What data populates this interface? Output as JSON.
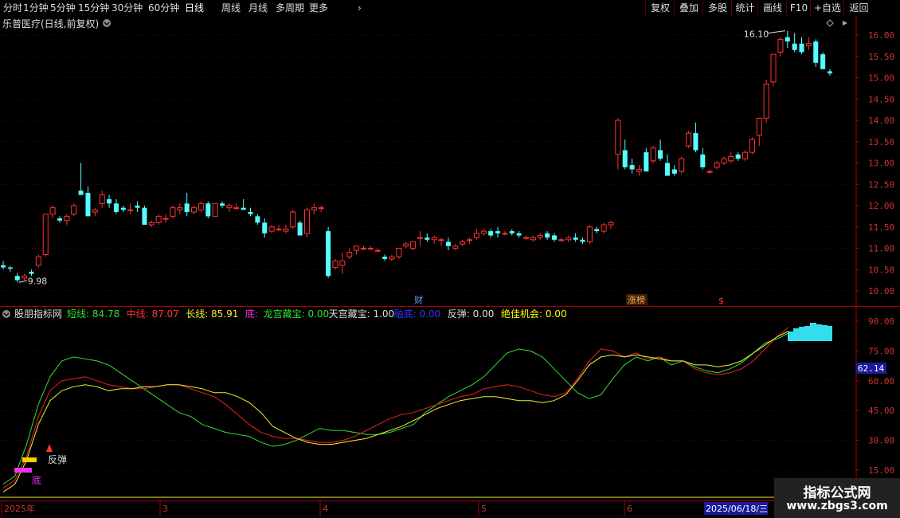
{
  "toolbar": {
    "periods": [
      "分时",
      "1分钟",
      "5分钟",
      "15分钟",
      "30分钟",
      "60分钟",
      "日线",
      "周线",
      "月线",
      "多周期",
      "更多"
    ],
    "active_period": "日线",
    "right_buttons": [
      "复权",
      "叠加",
      "多股",
      "统计",
      "画线",
      "F10",
      "+自选",
      "返回"
    ]
  },
  "main": {
    "title": "乐普医疗(日线,前复权)",
    "price_axis": [
      "16.00",
      "15.50",
      "15.00",
      "14.50",
      "14.00",
      "13.50",
      "13.00",
      "12.50",
      "12.00",
      "11.50",
      "11.00",
      "10.50",
      "10.00"
    ],
    "high_label": "16.10",
    "low_label": "9.98",
    "event_labels": {
      "cai": "财",
      "zhangbang": "涨榜",
      "s": "$"
    }
  },
  "indicator": {
    "name": "股朋指标网",
    "items": [
      {
        "label": "短线:",
        "value": "84.78",
        "color": "#33dd33"
      },
      {
        "label": "中线:",
        "value": "87.07",
        "color": "#ff3333"
      },
      {
        "label": "长线:",
        "value": "85.91",
        "color": "#eeee33"
      },
      {
        "label": "底:",
        "value": "",
        "color": "#ee33ee"
      },
      {
        "label": "龙宫藏宝:",
        "value": "0.00",
        "color": "#33dd33"
      },
      {
        "label": "天宫藏宝:",
        "value": "1.00",
        "color": "#dddddd"
      },
      {
        "label": "融底:",
        "value": "0.00",
        "color": "#3333ff"
      },
      {
        "label": "反弹:",
        "value": "0.00",
        "color": "#dddddd"
      },
      {
        "label": "绝佳机会:",
        "value": "0.00",
        "color": "#ffff00"
      }
    ],
    "axis": [
      "90.00",
      "75.00",
      "60.00",
      "45.00",
      "30.00",
      "15.00"
    ],
    "current_value": "62.14",
    "annotations": {
      "bounce": "反弹",
      "bottom": "底"
    }
  },
  "time_axis": {
    "labels": [
      "2025年",
      "3",
      "4",
      "5",
      "6"
    ],
    "cursor_date": "2025/06/18/三"
  },
  "watermark": {
    "line1": "指标公式网",
    "line2": "www.zbgs3.com"
  },
  "chart_data": [
    {
      "type": "candlestick",
      "title": "乐普医疗(日线,前复权)",
      "ylim": [
        9.8,
        16.3
      ],
      "candles": [
        [
          10.6,
          10.7,
          10.5,
          10.55
        ],
        [
          10.55,
          10.58,
          10.45,
          10.52
        ],
        [
          10.35,
          10.42,
          10.2,
          10.25
        ],
        [
          10.3,
          10.4,
          10.25,
          10.35
        ],
        [
          10.45,
          10.5,
          10.35,
          10.4
        ],
        [
          10.6,
          10.85,
          10.55,
          10.8
        ],
        [
          10.85,
          11.8,
          10.8,
          11.8
        ],
        [
          11.8,
          12.0,
          11.7,
          11.95
        ],
        [
          11.7,
          11.75,
          11.6,
          11.65
        ],
        [
          11.65,
          11.8,
          11.55,
          11.75
        ],
        [
          11.8,
          12.05,
          11.75,
          12.0
        ],
        [
          12.35,
          13.0,
          12.25,
          12.25
        ],
        [
          12.3,
          12.45,
          11.75,
          11.75
        ],
        [
          11.85,
          11.95,
          11.75,
          11.9
        ],
        [
          12.05,
          12.35,
          11.95,
          12.25
        ],
        [
          12.15,
          12.25,
          11.95,
          12.05
        ],
        [
          12.05,
          12.15,
          11.8,
          11.85
        ],
        [
          11.95,
          12.0,
          11.85,
          11.9
        ],
        [
          11.9,
          12.05,
          11.8,
          11.9
        ],
        [
          12.0,
          12.1,
          11.85,
          11.95
        ],
        [
          11.95,
          12.0,
          11.55,
          11.55
        ],
        [
          11.55,
          11.65,
          11.5,
          11.6
        ],
        [
          11.6,
          11.8,
          11.55,
          11.75
        ],
        [
          11.7,
          11.8,
          11.6,
          11.7
        ],
        [
          11.75,
          12.0,
          11.7,
          11.95
        ],
        [
          11.9,
          12.05,
          11.8,
          11.95
        ],
        [
          12.05,
          12.3,
          11.75,
          11.85
        ],
        [
          11.85,
          12.0,
          11.8,
          11.95
        ],
        [
          11.9,
          12.1,
          11.85,
          12.05
        ],
        [
          12.05,
          12.1,
          11.7,
          11.75
        ],
        [
          11.75,
          12.05,
          11.75,
          12.05
        ],
        [
          12.05,
          12.1,
          11.95,
          12.0
        ],
        [
          11.95,
          12.05,
          11.85,
          12.0
        ],
        [
          11.95,
          12.05,
          11.9,
          11.95
        ],
        [
          11.95,
          12.15,
          11.9,
          11.9
        ],
        [
          11.85,
          11.95,
          11.75,
          11.8
        ],
        [
          11.75,
          11.8,
          11.55,
          11.6
        ],
        [
          11.6,
          11.7,
          11.25,
          11.35
        ],
        [
          11.4,
          11.55,
          11.35,
          11.5
        ],
        [
          11.45,
          11.55,
          11.4,
          11.45
        ],
        [
          11.4,
          11.55,
          11.35,
          11.45
        ],
        [
          11.5,
          11.9,
          11.45,
          11.85
        ],
        [
          11.6,
          11.65,
          11.3,
          11.3
        ],
        [
          11.35,
          11.95,
          11.25,
          11.9
        ],
        [
          11.9,
          12.05,
          11.8,
          11.95
        ],
        [
          11.95,
          12.0,
          11.85,
          11.95
        ],
        [
          11.4,
          11.5,
          10.3,
          10.35
        ],
        [
          10.55,
          10.75,
          10.5,
          10.7
        ],
        [
          10.6,
          10.9,
          10.4,
          10.7
        ],
        [
          10.8,
          11.0,
          10.75,
          10.9
        ],
        [
          10.95,
          11.05,
          10.85,
          11.05
        ],
        [
          11.0,
          11.05,
          10.95,
          11.0
        ],
        [
          11.0,
          11.05,
          10.95,
          11.0
        ],
        [
          10.95,
          11.0,
          10.9,
          10.95
        ],
        [
          10.8,
          10.85,
          10.7,
          10.75
        ],
        [
          10.75,
          10.85,
          10.7,
          10.8
        ],
        [
          10.8,
          11.0,
          10.75,
          11.0
        ],
        [
          11.05,
          11.15,
          11.0,
          11.1
        ],
        [
          11.0,
          11.15,
          10.95,
          11.15
        ],
        [
          11.25,
          11.4,
          11.05,
          11.25
        ],
        [
          11.25,
          11.35,
          11.15,
          11.2
        ],
        [
          11.2,
          11.3,
          11.1,
          11.25
        ],
        [
          11.2,
          11.25,
          11.05,
          11.2
        ],
        [
          11.15,
          11.25,
          10.95,
          11.05
        ],
        [
          11.0,
          11.1,
          10.95,
          11.05
        ],
        [
          11.1,
          11.2,
          11.05,
          11.15
        ],
        [
          11.2,
          11.25,
          11.1,
          11.2
        ],
        [
          11.25,
          11.45,
          11.2,
          11.35
        ],
        [
          11.35,
          11.45,
          11.3,
          11.4
        ],
        [
          11.4,
          11.45,
          11.25,
          11.3
        ],
        [
          11.4,
          11.5,
          11.25,
          11.35
        ],
        [
          11.35,
          11.4,
          11.3,
          11.35
        ],
        [
          11.4,
          11.45,
          11.3,
          11.35
        ],
        [
          11.35,
          11.4,
          11.25,
          11.3
        ],
        [
          11.25,
          11.3,
          11.2,
          11.25
        ],
        [
          11.2,
          11.3,
          11.15,
          11.25
        ],
        [
          11.25,
          11.35,
          11.2,
          11.3
        ],
        [
          11.35,
          11.4,
          11.2,
          11.25
        ],
        [
          11.3,
          11.35,
          11.15,
          11.2
        ],
        [
          11.2,
          11.25,
          11.15,
          11.2
        ],
        [
          11.2,
          11.3,
          11.15,
          11.25
        ],
        [
          11.25,
          11.35,
          11.15,
          11.2
        ],
        [
          11.2,
          11.25,
          11.1,
          11.15
        ],
        [
          11.15,
          11.55,
          11.1,
          11.5
        ],
        [
          11.45,
          11.5,
          11.35,
          11.4
        ],
        [
          11.4,
          11.6,
          11.35,
          11.55
        ],
        [
          11.55,
          11.65,
          11.45,
          11.6
        ],
        [
          13.2,
          14.05,
          12.85,
          14.0
        ],
        [
          13.3,
          13.55,
          12.85,
          12.9
        ],
        [
          12.95,
          13.1,
          12.75,
          12.85
        ],
        [
          12.8,
          12.95,
          12.7,
          12.85
        ],
        [
          13.25,
          13.35,
          12.8,
          12.8
        ],
        [
          13.05,
          13.4,
          13.0,
          13.35
        ],
        [
          13.3,
          13.55,
          13.05,
          13.1
        ],
        [
          13.0,
          13.2,
          12.7,
          12.7
        ],
        [
          12.85,
          12.95,
          12.7,
          12.75
        ],
        [
          12.8,
          13.15,
          12.75,
          13.1
        ],
        [
          13.4,
          13.75,
          13.35,
          13.7
        ],
        [
          13.7,
          13.95,
          13.25,
          13.3
        ],
        [
          13.2,
          13.35,
          12.85,
          12.9
        ],
        [
          12.8,
          12.85,
          12.75,
          12.8
        ],
        [
          12.9,
          13.05,
          12.85,
          13.0
        ],
        [
          13.0,
          13.15,
          12.95,
          13.1
        ],
        [
          13.05,
          13.25,
          13.0,
          13.15
        ],
        [
          13.2,
          13.25,
          13.05,
          13.1
        ],
        [
          13.1,
          13.3,
          13.05,
          13.25
        ],
        [
          13.25,
          13.6,
          13.2,
          13.55
        ],
        [
          13.65,
          14.05,
          13.4,
          14.05
        ],
        [
          14.05,
          14.95,
          13.95,
          14.85
        ],
        [
          14.9,
          15.55,
          14.8,
          15.55
        ],
        [
          15.6,
          15.95,
          15.5,
          15.9
        ],
        [
          15.95,
          16.1,
          15.7,
          15.85
        ],
        [
          15.8,
          16.05,
          15.6,
          15.65
        ],
        [
          15.8,
          15.95,
          15.55,
          15.6
        ],
        [
          15.75,
          15.95,
          15.65,
          15.8
        ],
        [
          15.85,
          15.9,
          15.25,
          15.35
        ],
        [
          15.55,
          15.6,
          15.2,
          15.2
        ],
        [
          15.15,
          15.2,
          15.05,
          15.1
        ]
      ]
    },
    {
      "type": "line",
      "title": "股朋指标网",
      "ylim": [
        10,
        97
      ],
      "series": [
        {
          "name": "短线",
          "values": [
            8,
            12,
            28,
            48,
            62,
            70,
            72,
            71,
            70,
            68,
            64,
            60,
            56,
            52,
            48,
            44,
            42,
            38,
            36,
            34,
            33,
            32,
            29,
            27,
            28,
            30,
            33,
            36,
            35,
            35,
            34,
            33,
            33,
            34,
            36,
            38,
            44,
            48,
            52,
            55,
            58,
            62,
            68,
            74,
            76,
            75,
            72,
            66,
            60,
            54,
            51,
            53,
            61,
            68,
            72,
            70,
            72,
            68,
            70,
            67,
            65,
            64,
            66,
            69,
            74,
            79,
            81,
            84
          ]
        },
        {
          "name": "中线",
          "values": [
            6,
            10,
            22,
            42,
            55,
            60,
            61,
            62,
            60,
            58,
            57,
            56,
            56,
            57,
            58,
            58,
            56,
            54,
            52,
            48,
            43,
            38,
            34,
            32,
            31,
            31,
            30,
            29,
            29,
            30,
            32,
            35,
            38,
            41,
            43,
            44,
            46,
            48,
            50,
            52,
            53,
            56,
            57,
            58,
            57,
            55,
            53,
            52,
            54,
            61,
            70,
            76,
            75,
            72,
            74,
            71,
            72,
            70,
            70,
            66,
            64,
            63,
            64,
            66,
            70,
            76,
            82,
            87
          ]
        },
        {
          "name": "长线",
          "values": [
            4,
            8,
            20,
            38,
            50,
            55,
            57,
            58,
            57,
            55,
            56,
            56,
            57,
            57,
            58,
            58,
            57,
            56,
            54,
            54,
            52,
            49,
            44,
            37,
            34,
            31,
            29,
            28,
            28,
            29,
            30,
            31,
            33,
            35,
            37,
            40,
            43,
            46,
            48,
            50,
            51,
            52,
            52,
            51,
            50,
            50,
            49,
            50,
            53,
            60,
            68,
            72,
            73,
            72,
            73,
            72,
            71,
            70,
            70,
            68,
            68,
            67,
            68,
            70,
            74,
            78,
            82,
            85
          ]
        }
      ]
    }
  ]
}
